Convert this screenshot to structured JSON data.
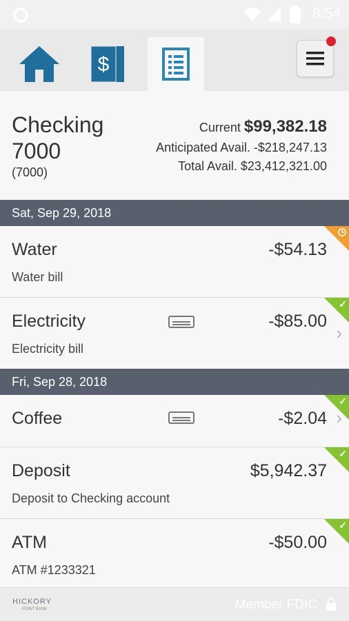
{
  "status_bar": {
    "time": "8:54"
  },
  "tabs": [
    {
      "name": "home",
      "icon": "home-icon",
      "active": false
    },
    {
      "name": "accounts",
      "icon": "dollar-cards-icon",
      "active": false
    },
    {
      "name": "transactions",
      "icon": "ledger-icon",
      "active": true
    }
  ],
  "colors": {
    "brand_blue": "#1f6e9c",
    "date_bar": "#57606c",
    "pending": "#f0a030",
    "cleared": "#86c332",
    "notification": "#e02030"
  },
  "account": {
    "name_line1": "Checking",
    "name_line2": "7000",
    "number": "(7000)",
    "current_label": "Current",
    "current_value": "$99,382.18",
    "anticipated": "Anticipated Avail. -$218,247.13",
    "total": "Total Avail. $23,412,321.00"
  },
  "groups": [
    {
      "date": "Sat, Sep 29, 2018"
    },
    {
      "date": "Fri, Sep 28, 2018"
    }
  ],
  "transactions": [
    {
      "name": "Water",
      "description": "Water bill",
      "amount": "-$54.13",
      "status": "pending"
    },
    {
      "name": "Electricity",
      "description": "Electricity bill",
      "amount": "-$85.00",
      "status": "cleared"
    },
    {
      "name": "Coffee",
      "description": "",
      "amount": "-$2.04",
      "status": "cleared"
    },
    {
      "name": "Deposit",
      "description": "Deposit to Checking account",
      "amount": "$5,942.37",
      "status": "cleared"
    },
    {
      "name": "ATM",
      "description": "ATM #1233321",
      "amount": "-$50.00",
      "status": "cleared"
    }
  ],
  "footer": {
    "logo": "HICKORY",
    "logo_sub": "POINT BANK",
    "fdic": "Member FDIC"
  }
}
